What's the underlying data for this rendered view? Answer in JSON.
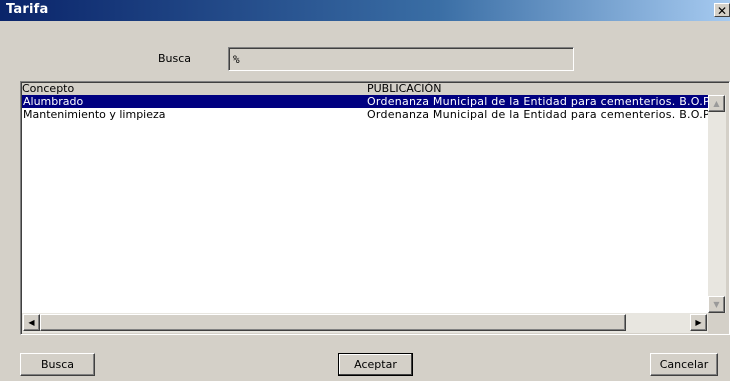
{
  "window": {
    "title": "Tarifa",
    "close_glyph": "✕"
  },
  "search": {
    "label": "Busca",
    "value": "%"
  },
  "list": {
    "columns": [
      "Concepto",
      "PUBLICACIÓN"
    ],
    "rows": [
      {
        "concepto": "Alumbrado",
        "publicacion": "Ordenanza Municipal de la Entidad para cementerios. B.O.P",
        "selected": true
      },
      {
        "concepto": "Mantenimiento y limpieza",
        "publicacion": "Ordenanza Municipal de la Entidad para cementerios. B.O.P",
        "selected": false
      }
    ],
    "scroll_glyphs": {
      "up": "▲",
      "down": "▼",
      "left": "◀",
      "right": "▶"
    }
  },
  "buttons": {
    "busca": "Busca",
    "aceptar": "Aceptar",
    "cancelar": "Cancelar"
  },
  "colors": {
    "selection_bg": "#000080",
    "dialog_bg": "#d4d0c8"
  }
}
